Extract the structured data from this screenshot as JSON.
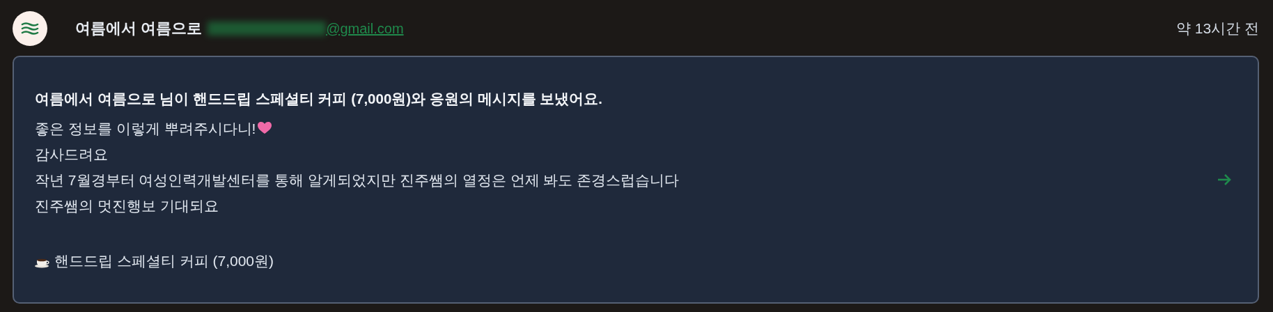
{
  "sender": {
    "name": "여름에서 여름으로",
    "email_domain": "@gmail.com"
  },
  "time": "약 13시간 전",
  "card": {
    "title": "여름에서 여름으로 님이 핸드드립 스페셜티 커피 (7,000원)와 응원의 메시지를 보냈어요.",
    "message_lines": [
      {
        "text": "좋은 정보를 이렇게 뿌려주시다니!",
        "kind": "heart"
      },
      {
        "text": "감사드려요",
        "kind": "plain"
      },
      {
        "text": "작년 7월경부터 여성인력개발센터를 통해 알게되었지만 진주쌤의 열정은 언제 봐도 존경스럽습니다",
        "kind": "plain"
      },
      {
        "text": "진주쌤의 멋진행보 기대되요",
        "kind": "plain"
      }
    ],
    "item": "핸드드립 스페셜티 커피 (7,000원)"
  }
}
